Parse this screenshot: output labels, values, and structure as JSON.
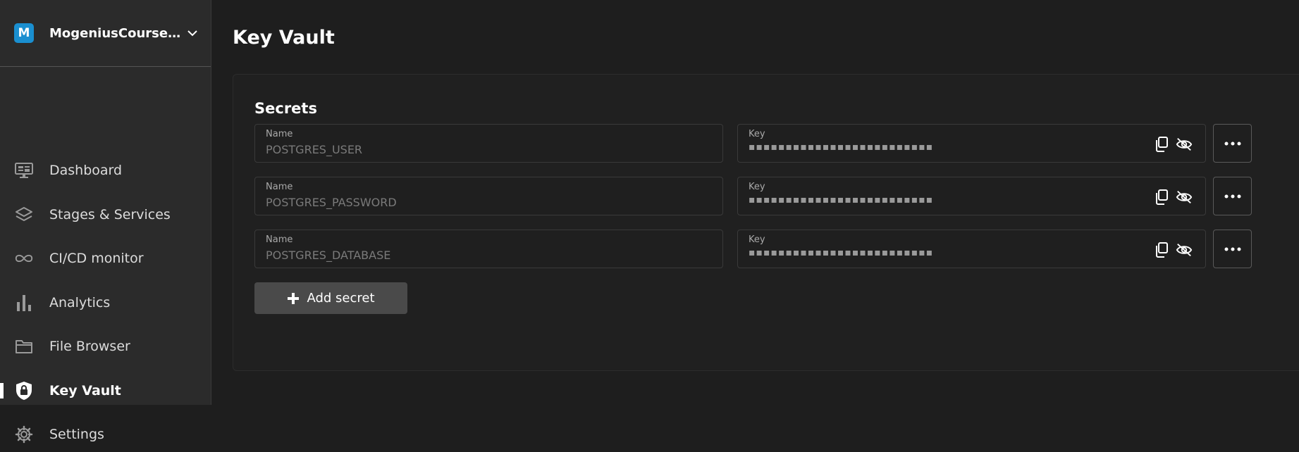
{
  "org": {
    "initial": "M",
    "name": "MogeniusCourseArm..."
  },
  "nav": [
    {
      "label": "Dashboard",
      "icon": "monitor-icon"
    },
    {
      "label": "Stages & Services",
      "icon": "layers-icon"
    },
    {
      "label": "CI/CD monitor",
      "icon": "infinity-icon"
    },
    {
      "label": "Analytics",
      "icon": "bar-chart-icon"
    },
    {
      "label": "File Browser",
      "icon": "folder-icon"
    },
    {
      "label": "Key Vault",
      "icon": "shield-lock-icon",
      "active": true
    },
    {
      "label": "Settings",
      "icon": "gear-icon"
    }
  ],
  "page": {
    "title": "Key Vault"
  },
  "secrets": {
    "title": "Secrets",
    "name_label": "Name",
    "key_label": "Key",
    "masked": "▪▪▪▪▪▪▪▪▪▪▪▪▪▪▪▪▪▪▪▪▪▪▪▪▪",
    "rows": [
      {
        "name": "POSTGRES_USER"
      },
      {
        "name": "POSTGRES_PASSWORD"
      },
      {
        "name": "POSTGRES_DATABASE"
      }
    ],
    "add_label": "Add secret"
  },
  "colors": {
    "accent": "#1a8fd0",
    "background": "#1e1e1e",
    "sidebar": "#2b2b2b"
  }
}
